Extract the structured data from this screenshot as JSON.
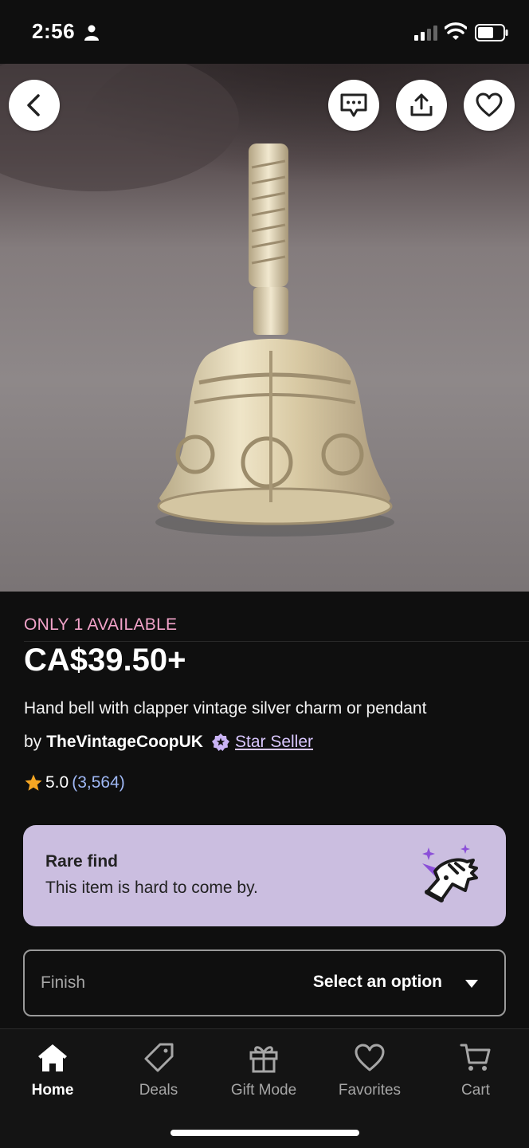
{
  "status_bar": {
    "time": "2:56",
    "icons": [
      "person-icon",
      "cellular-signal-icon",
      "wifi-icon",
      "battery-icon"
    ]
  },
  "hero": {
    "image": "silver-hand-bell-photo",
    "buttons": [
      "back-arrow-icon",
      "message-icon",
      "share-icon",
      "heart-icon"
    ]
  },
  "product": {
    "availability": "ONLY 1 AVAILABLE",
    "price": "CA$39.50+",
    "title": "Hand bell with clapper vintage silver charm or pendant",
    "seller_prefix": "by",
    "seller_name": "TheVintageCoopUK",
    "star_seller_label": "Star Seller",
    "rating": "5.0",
    "review_count": "(3,564)"
  },
  "rare_find": {
    "title": "Rare find",
    "description": "This item is hard to come by.",
    "icon": "unicorn-icon"
  },
  "variation": {
    "label": "Finish",
    "value": "Select an option"
  },
  "bottom_nav": {
    "items": [
      {
        "label": "Home",
        "icon": "home-icon",
        "active": true
      },
      {
        "label": "Deals",
        "icon": "tag-icon",
        "active": false
      },
      {
        "label": "Gift Mode",
        "icon": "gift-icon",
        "active": false
      },
      {
        "label": "Favorites",
        "icon": "heart-icon",
        "active": false
      },
      {
        "label": "Cart",
        "icon": "cart-icon",
        "active": false
      }
    ]
  },
  "colors": {
    "background": "#0f0f0f",
    "availability": "#f2a3c9",
    "star_seller": "#d9c7ff",
    "rating_count": "#9fb8f5",
    "rating_star": "#f5a623",
    "rare_card": "#cbbee0"
  }
}
